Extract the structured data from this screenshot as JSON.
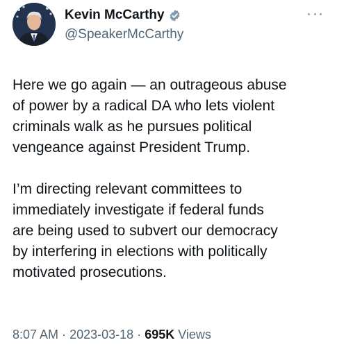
{
  "author": {
    "display_name": "Kevin McCarthy",
    "handle": "@SpeakerMcCarthy",
    "verified_color": "#829aab",
    "avatar_icon": "profile-photo"
  },
  "tweet": {
    "paragraphs": [
      "Here we go again — an outrageous abuse\nof power by a radical DA who lets violent\ncriminals walk as he pursues political\nvengeance against President Trump.",
      "I’m directing relevant committees to\nimmediately investigate if federal funds\nare being used to subvert our democracy\nby interfering in elections with politically\nmotivated prosecutions."
    ]
  },
  "meta": {
    "time": "8:07 AM",
    "separator": "·",
    "date": "2023-03-18",
    "views_count": "695K",
    "views_label": "Views"
  },
  "colors": {
    "text": "#0f1419",
    "secondary": "#536471"
  }
}
